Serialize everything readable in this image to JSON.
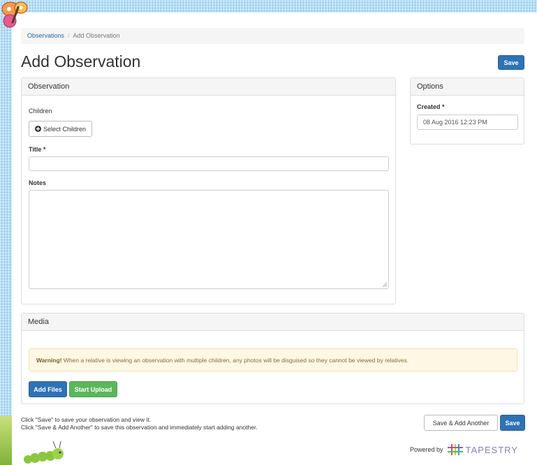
{
  "breadcrumb": {
    "parent": "Observations",
    "current": "Add Observation"
  },
  "page": {
    "title": "Add Observation",
    "save_label": "Save"
  },
  "observation_panel": {
    "heading": "Observation",
    "children_label": "Children",
    "select_children_label": "Select Children",
    "title_label": "Title *",
    "title_value": "",
    "notes_label": "Notes",
    "notes_value": ""
  },
  "options_panel": {
    "heading": "Options",
    "created_label": "Created *",
    "created_value": "08 Aug 2016 12:23 PM"
  },
  "media_panel": {
    "heading": "Media",
    "warning_strong": "Warning!",
    "warning_text": " When a relative is viewing an observation with multiple children, any photos will be disguised so they cannot be viewed by relatives.",
    "add_files_label": "Add Files",
    "start_upload_label": "Start Upload"
  },
  "footer": {
    "help_line_1": "Click \"Save\" to save your observation and view it.",
    "help_line_2": "Click \"Save & Add Another\" to save this observation and immediately start adding another.",
    "save_add_another_label": "Save & Add Another",
    "save_label": "Save",
    "powered_by": "Powered by",
    "brand": "TAPESTRY"
  },
  "colors": {
    "primary": "#2f72b5",
    "success": "#5bb75b",
    "warning_bg": "#fcf8e3",
    "frame": "#9fd3f1"
  },
  "icons": {
    "butterfly": "butterfly-icon",
    "caterpillar": "caterpillar-icon",
    "plus_circle": "plus-circle-icon",
    "resize": "resize-grip-icon",
    "tapestry_logo": "tapestry-logo-icon"
  }
}
